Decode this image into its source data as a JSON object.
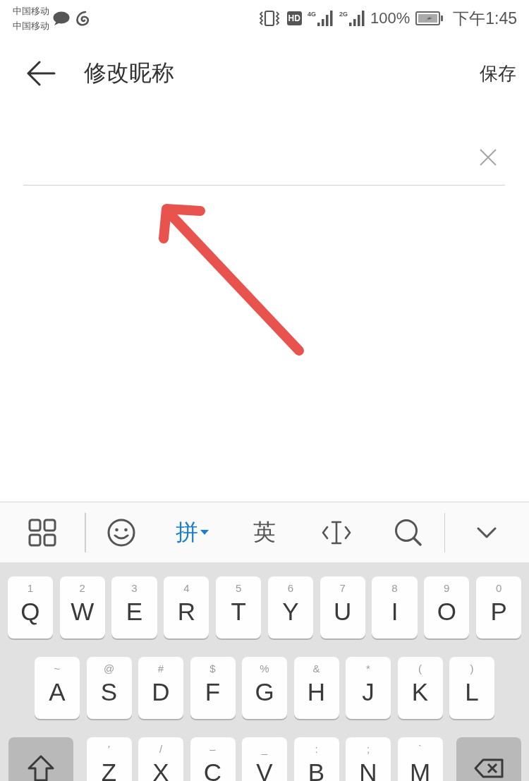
{
  "status_bar": {
    "carriers": [
      "中国移动",
      "中国移动"
    ],
    "hd": "HD",
    "networks": [
      "4G",
      "2G"
    ],
    "battery": "100%",
    "time": "下午1:45"
  },
  "header": {
    "title": "修改昵称",
    "save": "保存"
  },
  "keyboard": {
    "input_modes": [
      {
        "label": "拼",
        "selected": true
      },
      {
        "label": "英",
        "selected": false
      }
    ],
    "rows": [
      [
        {
          "kind": "letter",
          "label": "Q",
          "hint": "1"
        },
        {
          "kind": "letter",
          "label": "W",
          "hint": "2"
        },
        {
          "kind": "letter",
          "label": "E",
          "hint": "3"
        },
        {
          "kind": "letter",
          "label": "R",
          "hint": "4"
        },
        {
          "kind": "letter",
          "label": "T",
          "hint": "5"
        },
        {
          "kind": "letter",
          "label": "Y",
          "hint": "6"
        },
        {
          "kind": "letter",
          "label": "U",
          "hint": "7"
        },
        {
          "kind": "letter",
          "label": "I",
          "hint": "8"
        },
        {
          "kind": "letter",
          "label": "O",
          "hint": "9"
        },
        {
          "kind": "letter",
          "label": "P",
          "hint": "0"
        }
      ],
      [
        {
          "kind": "letter",
          "label": "A",
          "hint": "~"
        },
        {
          "kind": "letter",
          "label": "S",
          "hint": "@"
        },
        {
          "kind": "letter",
          "label": "D",
          "hint": "#"
        },
        {
          "kind": "letter",
          "label": "F",
          "hint": "$"
        },
        {
          "kind": "letter",
          "label": "G",
          "hint": "%"
        },
        {
          "kind": "letter",
          "label": "H",
          "hint": "&"
        },
        {
          "kind": "letter",
          "label": "J",
          "hint": "*"
        },
        {
          "kind": "letter",
          "label": "K",
          "hint": "("
        },
        {
          "kind": "letter",
          "label": "L",
          "hint": ")"
        }
      ],
      [
        {
          "kind": "shift"
        },
        {
          "kind": "letter",
          "label": "Z",
          "hint": "′"
        },
        {
          "kind": "letter",
          "label": "X",
          "hint": "/"
        },
        {
          "kind": "letter",
          "label": "C",
          "hint": "–"
        },
        {
          "kind": "letter",
          "label": "V",
          "hint": "_"
        },
        {
          "kind": "letter",
          "label": "B",
          "hint": ":"
        },
        {
          "kind": "letter",
          "label": "N",
          "hint": ";"
        },
        {
          "kind": "letter",
          "label": "M",
          "hint": "`"
        },
        {
          "kind": "delete"
        }
      ]
    ]
  }
}
